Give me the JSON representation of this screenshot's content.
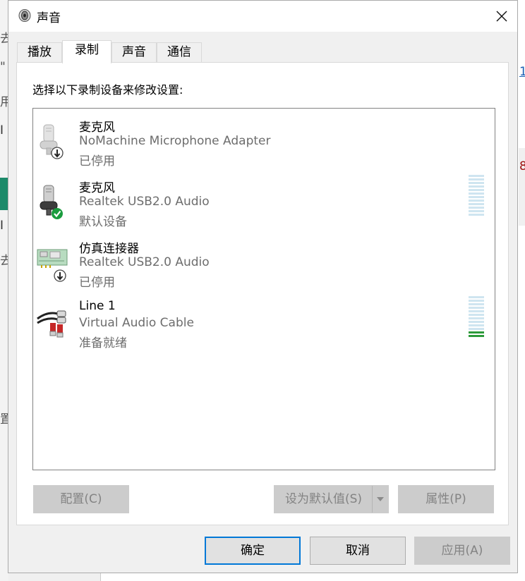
{
  "background": {
    "left_fragments": [
      "去",
      "\"",
      "用",
      "I",
      "I",
      "去",
      "置"
    ],
    "right_fragments": [
      "1",
      "8"
    ]
  },
  "window": {
    "title": "声音",
    "icon": "speaker-icon",
    "close_icon": "close-icon"
  },
  "tabs": [
    {
      "label": "播放",
      "active": false
    },
    {
      "label": "录制",
      "active": true
    },
    {
      "label": "声音",
      "active": false
    },
    {
      "label": "通信",
      "active": false
    }
  ],
  "instruction": "选择以下录制设备来修改设置:",
  "devices": [
    {
      "name": "麦克风",
      "description": "NoMachine Microphone Adapter",
      "status": "已停用",
      "icon": "microphone-icon",
      "badge": "disabled-arrow-icon",
      "level": null
    },
    {
      "name": "麦克风",
      "description": "Realtek USB2.0 Audio",
      "status": "默认设备",
      "icon": "microphone-icon",
      "badge": "default-check-icon",
      "level": 0
    },
    {
      "name": "仿真连接器",
      "description": "Realtek USB2.0 Audio",
      "status": "已停用",
      "icon": "circuit-board-icon",
      "badge": "disabled-arrow-icon",
      "level": null
    },
    {
      "name": "Line 1",
      "description": "Virtual Audio Cable",
      "status": "准备就绪",
      "icon": "rca-cable-icon",
      "badge": null,
      "level": 0.2
    }
  ],
  "panel_buttons": {
    "configure": "配置(C)",
    "set_default": "设为默认值(S)",
    "properties": "属性(P)"
  },
  "dialog_buttons": {
    "ok": "确定",
    "cancel": "取消",
    "apply": "应用(A)"
  },
  "colors": {
    "accent": "#0078d7",
    "meter_idle": "#cfe5f0",
    "meter_active": "#2d9a3a",
    "default_badge": "#1a9c3e"
  }
}
